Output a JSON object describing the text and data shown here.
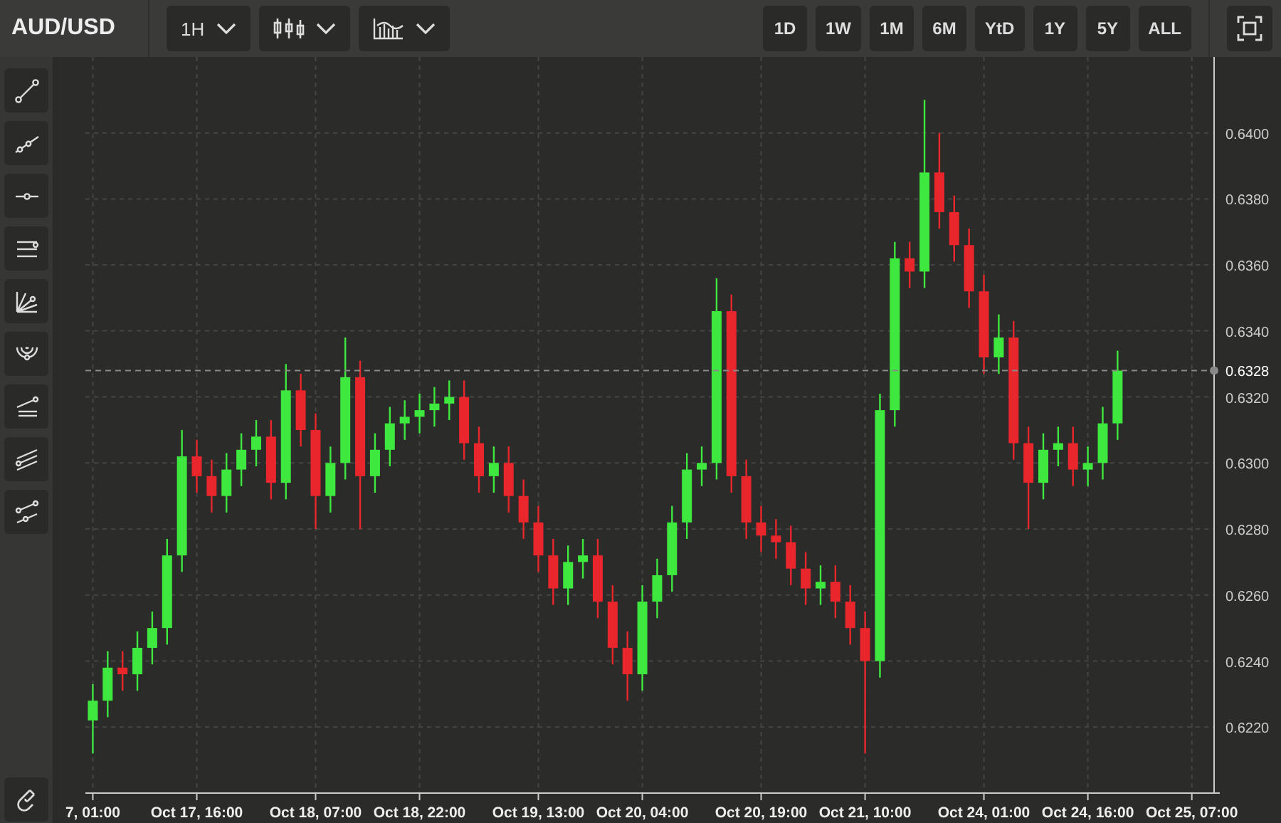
{
  "header": {
    "symbol": "AUD/USD",
    "dropdowns": [
      {
        "kind": "text",
        "label": "1H"
      },
      {
        "kind": "candles"
      },
      {
        "kind": "indicators"
      }
    ],
    "ranges": [
      {
        "label": "1D",
        "selected": false
      },
      {
        "label": "1W",
        "selected": false
      },
      {
        "label": "1M",
        "selected": false
      },
      {
        "label": "6M",
        "selected": false
      },
      {
        "label": "YtD",
        "selected": false
      },
      {
        "label": "1Y",
        "selected": false
      },
      {
        "label": "5Y",
        "selected": false
      },
      {
        "label": "ALL",
        "selected": false
      }
    ]
  },
  "tools": [
    {
      "kind": "segment"
    },
    {
      "kind": "ray"
    },
    {
      "kind": "hline"
    },
    {
      "kind": "channel"
    },
    {
      "kind": "fan"
    },
    {
      "kind": "arc"
    },
    {
      "kind": "pitchfork"
    },
    {
      "kind": "parallel"
    },
    {
      "kind": "pair"
    }
  ],
  "chart": {
    "chart_data": {
      "type": "candlestick",
      "grid": true,
      "ylim": [
        0.62,
        0.6423
      ],
      "categories": [
        "7, 01:00",
        null,
        null,
        null,
        null,
        null,
        null,
        "Oct 17, 16:00",
        null,
        null,
        null,
        null,
        null,
        null,
        null,
        "Oct 18, 07:00",
        null,
        null,
        null,
        null,
        null,
        null,
        "Oct 18, 22:00",
        null,
        null,
        null,
        null,
        null,
        null,
        null,
        "Oct 19, 13:00",
        null,
        null,
        null,
        null,
        null,
        null,
        "Oct 20, 04:00",
        null,
        null,
        null,
        null,
        null,
        null,
        null,
        "Oct 20, 19:00",
        null,
        null,
        null,
        null,
        null,
        null,
        "Oct 21, 10:00",
        null,
        null,
        null,
        null,
        null,
        null,
        null,
        "Oct 24, 01:00",
        null,
        null,
        null,
        null,
        null,
        null,
        "Oct 24, 16:00",
        null,
        null,
        null,
        null,
        null,
        null,
        "Oct 25, 07:00",
        null
      ],
      "yticks": [
        {
          "value": 0.622,
          "label": "0.6220"
        },
        {
          "value": 0.624,
          "label": "0.6240"
        },
        {
          "value": 0.626,
          "label": "0.6260"
        },
        {
          "value": 0.628,
          "label": "0.6280"
        },
        {
          "value": 0.63,
          "label": "0.6300"
        },
        {
          "value": 0.632,
          "label": "0.6320"
        },
        {
          "value": 0.634,
          "label": "0.6340"
        },
        {
          "value": 0.636,
          "label": "0.6360"
        },
        {
          "value": 0.638,
          "label": "0.6380"
        },
        {
          "value": 0.64,
          "label": "0.6400"
        }
      ],
      "ref_lines": [
        {
          "axis": "y",
          "value": 0.6328,
          "label": "0.6328"
        }
      ],
      "ohlc": [
        [
          0.6222,
          0.6233,
          0.6212,
          0.6228
        ],
        [
          0.6228,
          0.6243,
          0.6223,
          0.6238
        ],
        [
          0.6238,
          0.6243,
          0.6231,
          0.6236
        ],
        [
          0.6236,
          0.6249,
          0.6231,
          0.6244
        ],
        [
          0.6244,
          0.6255,
          0.6239,
          0.625
        ],
        [
          0.625,
          0.6277,
          0.6245,
          0.6272
        ],
        [
          0.6272,
          0.631,
          0.6267,
          0.6302
        ],
        [
          0.6302,
          0.6307,
          0.6291,
          0.6296
        ],
        [
          0.6296,
          0.6301,
          0.6285,
          0.629
        ],
        [
          0.629,
          0.6303,
          0.6285,
          0.6298
        ],
        [
          0.6298,
          0.6309,
          0.6293,
          0.6304
        ],
        [
          0.6304,
          0.6313,
          0.6299,
          0.6308
        ],
        [
          0.6308,
          0.6313,
          0.6289,
          0.6294
        ],
        [
          0.6294,
          0.633,
          0.6289,
          0.6322
        ],
        [
          0.6322,
          0.6327,
          0.6305,
          0.631
        ],
        [
          0.631,
          0.6315,
          0.628,
          0.629
        ],
        [
          0.629,
          0.6305,
          0.6285,
          0.63
        ],
        [
          0.63,
          0.6338,
          0.6295,
          0.6326
        ],
        [
          0.6326,
          0.6331,
          0.628,
          0.6296
        ],
        [
          0.6296,
          0.6309,
          0.6291,
          0.6304
        ],
        [
          0.6304,
          0.6317,
          0.6299,
          0.6312
        ],
        [
          0.6312,
          0.6319,
          0.6307,
          0.6314
        ],
        [
          0.6314,
          0.6321,
          0.6309,
          0.6316
        ],
        [
          0.6316,
          0.6323,
          0.6311,
          0.6318
        ],
        [
          0.6318,
          0.6325,
          0.6313,
          0.632
        ],
        [
          0.632,
          0.6325,
          0.6301,
          0.6306
        ],
        [
          0.6306,
          0.6311,
          0.6291,
          0.6296
        ],
        [
          0.6296,
          0.6305,
          0.6291,
          0.63
        ],
        [
          0.63,
          0.6305,
          0.6285,
          0.629
        ],
        [
          0.629,
          0.6295,
          0.6277,
          0.6282
        ],
        [
          0.6282,
          0.6287,
          0.6267,
          0.6272
        ],
        [
          0.6272,
          0.6277,
          0.6257,
          0.6262
        ],
        [
          0.6262,
          0.6275,
          0.6257,
          0.627
        ],
        [
          0.627,
          0.6277,
          0.6265,
          0.6272
        ],
        [
          0.6272,
          0.6277,
          0.6253,
          0.6258
        ],
        [
          0.6258,
          0.6263,
          0.6239,
          0.6244
        ],
        [
          0.6244,
          0.6249,
          0.6228,
          0.6236
        ],
        [
          0.6236,
          0.6263,
          0.6231,
          0.6258
        ],
        [
          0.6258,
          0.6271,
          0.6253,
          0.6266
        ],
        [
          0.6266,
          0.6287,
          0.6261,
          0.6282
        ],
        [
          0.6282,
          0.6303,
          0.6277,
          0.6298
        ],
        [
          0.6298,
          0.6305,
          0.6293,
          0.63
        ],
        [
          0.63,
          0.6356,
          0.6295,
          0.6346
        ],
        [
          0.6346,
          0.6351,
          0.6291,
          0.6296
        ],
        [
          0.6296,
          0.6301,
          0.6277,
          0.6282
        ],
        [
          0.6282,
          0.6287,
          0.6273,
          0.6278
        ],
        [
          0.6278,
          0.6283,
          0.6271,
          0.6276
        ],
        [
          0.6276,
          0.6281,
          0.6263,
          0.6268
        ],
        [
          0.6268,
          0.6273,
          0.6257,
          0.6262
        ],
        [
          0.6262,
          0.6269,
          0.6257,
          0.6264
        ],
        [
          0.6264,
          0.6269,
          0.6253,
          0.6258
        ],
        [
          0.6258,
          0.6263,
          0.6245,
          0.625
        ],
        [
          0.625,
          0.6255,
          0.6212,
          0.624
        ],
        [
          0.624,
          0.6321,
          0.6235,
          0.6316
        ],
        [
          0.6316,
          0.6367,
          0.6311,
          0.6362
        ],
        [
          0.6362,
          0.6367,
          0.6353,
          0.6358
        ],
        [
          0.6358,
          0.641,
          0.6353,
          0.6388
        ],
        [
          0.6388,
          0.64,
          0.6371,
          0.6376
        ],
        [
          0.6376,
          0.6381,
          0.6361,
          0.6366
        ],
        [
          0.6366,
          0.6371,
          0.6347,
          0.6352
        ],
        [
          0.6352,
          0.6357,
          0.6327,
          0.6332
        ],
        [
          0.6332,
          0.6345,
          0.6327,
          0.6338
        ],
        [
          0.6338,
          0.6343,
          0.6301,
          0.6306
        ],
        [
          0.6306,
          0.6311,
          0.628,
          0.6294
        ],
        [
          0.6294,
          0.6309,
          0.6289,
          0.6304
        ],
        [
          0.6304,
          0.6311,
          0.6299,
          0.6306
        ],
        [
          0.6306,
          0.6311,
          0.6293,
          0.6298
        ],
        [
          0.6298,
          0.6305,
          0.6293,
          0.63
        ],
        [
          0.63,
          0.6317,
          0.6295,
          0.6312
        ],
        [
          0.6312,
          0.6334,
          0.6307,
          0.6328
        ],
        null,
        null,
        null,
        null,
        null,
        null
      ]
    }
  }
}
